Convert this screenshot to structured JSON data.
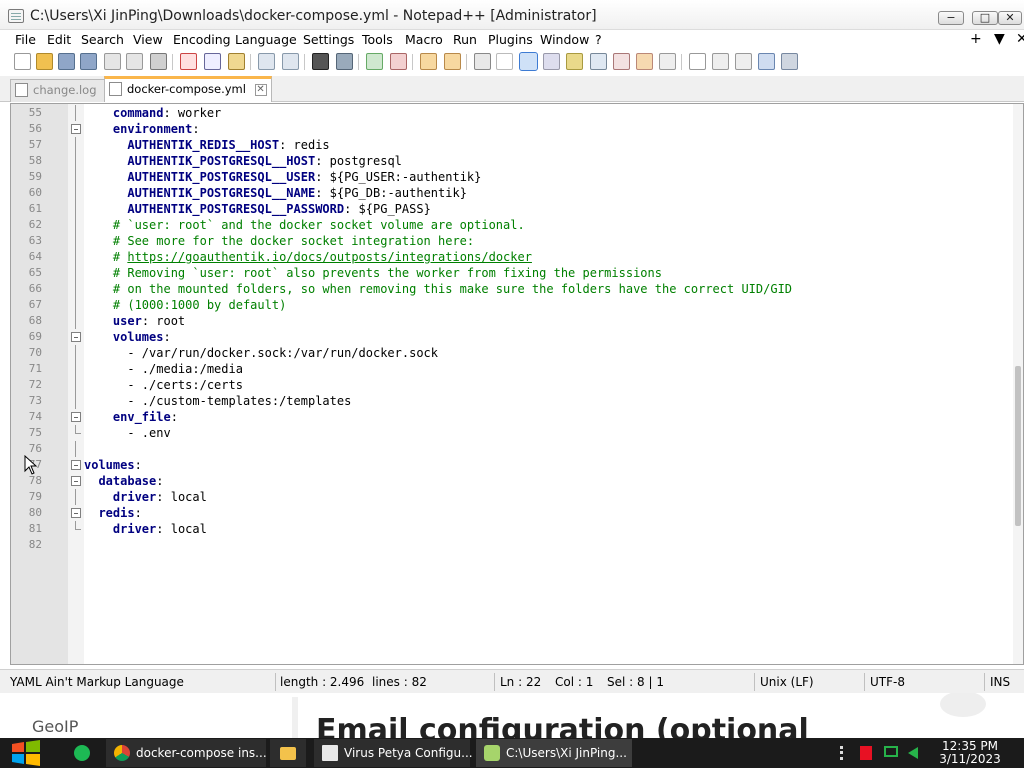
{
  "window": {
    "title": "C:\\Users\\Xi JinPing\\Downloads\\docker-compose.yml - Notepad++ [Administrator]",
    "min_label": "−",
    "max_label": "□",
    "close_label": "✕"
  },
  "menu": {
    "items": [
      "File",
      "Edit",
      "Search",
      "View",
      "Encoding",
      "Language",
      "Settings",
      "Tools",
      "Macro",
      "Run",
      "Plugins",
      "Window",
      "?"
    ],
    "right_glyphs": [
      "+",
      "▼",
      "✕"
    ]
  },
  "tabs": [
    {
      "label": "change.log",
      "close": "✕",
      "active": false
    },
    {
      "label": "docker-compose.yml",
      "close": "✕",
      "active": true
    }
  ],
  "editor": {
    "lines": [
      {
        "n": "55",
        "text": "    command: worker"
      },
      {
        "n": "56",
        "text": "    environment:"
      },
      {
        "n": "57",
        "text": "      AUTHENTIK_REDIS__HOST: redis"
      },
      {
        "n": "58",
        "text": "      AUTHENTIK_POSTGRESQL__HOST: postgresql"
      },
      {
        "n": "59",
        "text": "      AUTHENTIK_POSTGRESQL__USER: ${PG_USER:-authentik}"
      },
      {
        "n": "60",
        "text": "      AUTHENTIK_POSTGRESQL__NAME: ${PG_DB:-authentik}"
      },
      {
        "n": "61",
        "text": "      AUTHENTIK_POSTGRESQL__PASSWORD: ${PG_PASS}"
      },
      {
        "n": "62",
        "text": "    # `user: root` and the docker socket volume are optional."
      },
      {
        "n": "63",
        "text": "    # See more for the docker socket integration here:"
      },
      {
        "n": "64",
        "text": "    # https://goauthentik.io/docs/outposts/integrations/docker"
      },
      {
        "n": "65",
        "text": "    # Removing `user: root` also prevents the worker from fixing the permissions"
      },
      {
        "n": "66",
        "text": "    # on the mounted folders, so when removing this make sure the folders have the correct UID/GID"
      },
      {
        "n": "67",
        "text": "    # (1000:1000 by default)"
      },
      {
        "n": "68",
        "text": "    user: root"
      },
      {
        "n": "69",
        "text": "    volumes:"
      },
      {
        "n": "70",
        "text": "      - /var/run/docker.sock:/var/run/docker.sock"
      },
      {
        "n": "71",
        "text": "      - ./media:/media"
      },
      {
        "n": "72",
        "text": "      - ./certs:/certs"
      },
      {
        "n": "73",
        "text": "      - ./custom-templates:/templates"
      },
      {
        "n": "74",
        "text": "    env_file:"
      },
      {
        "n": "75",
        "text": "      - .env"
      },
      {
        "n": "76",
        "text": ""
      },
      {
        "n": "77",
        "text": "volumes:"
      },
      {
        "n": "78",
        "text": "  database:"
      },
      {
        "n": "79",
        "text": "    driver: local"
      },
      {
        "n": "80",
        "text": "  redis:"
      },
      {
        "n": "81",
        "text": "    driver: local"
      },
      {
        "n": "82",
        "text": ""
      }
    ]
  },
  "status": {
    "language": "YAML Ain't Markup Language",
    "length": "length : 2.496",
    "lines": "lines : 82",
    "ln": "Ln : 22",
    "col": "Col : 1",
    "sel": "Sel : 8 | 1",
    "eol": "Unix (LF)",
    "encoding": "UTF-8",
    "mode": "INS"
  },
  "background_page": {
    "sidebar_item": "GeoIP",
    "heading": "Email configuration (optional"
  },
  "taskbar": {
    "items": [
      {
        "label": "docker-compose ins...",
        "icon": "chrome-icon"
      },
      {
        "label": "Virus Petya Configu...",
        "icon": "document-icon"
      },
      {
        "label": "C:\\Users\\Xi JinPing...",
        "icon": "notepadpp-icon"
      }
    ],
    "time": "12:35 PM",
    "date": "3/11/2023"
  },
  "colors": {
    "keyword": "#000080",
    "comment": "#008000",
    "active_tab_accent": "#fab64b",
    "taskbar": "#1b1b1b"
  }
}
